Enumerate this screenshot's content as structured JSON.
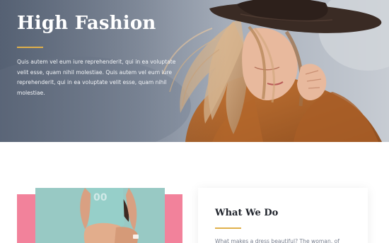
{
  "hero": {
    "title": "High Fashion",
    "paragraph": "Quis autem vel eum iure reprehenderit, qui in ea voluptate velit esse, quam nihil molestiae. Quis autem vel eum iure reprehenderit, qui in ea voluptate velit esse, quam nihil molestiae.",
    "accent_color": "#e0b04a"
  },
  "feature": {
    "backdrop_color": "#f2829b",
    "photo_bg_color": "#8fc4bf"
  },
  "what_we_do": {
    "title": "What We Do",
    "text": "What makes a dress beautiful? The woman, of"
  }
}
